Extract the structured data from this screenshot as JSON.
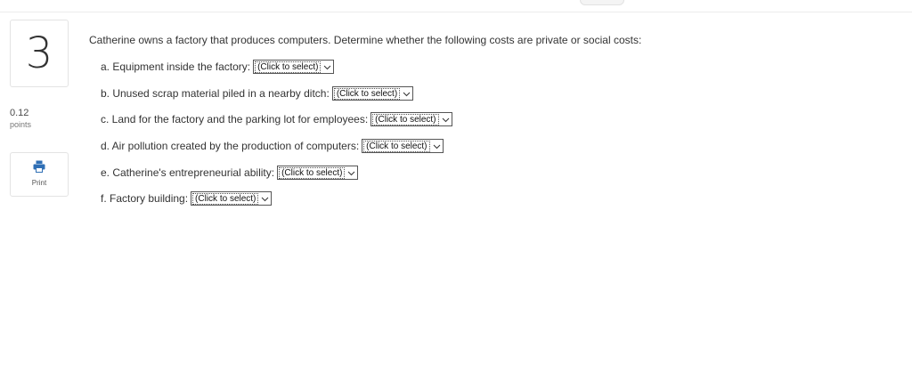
{
  "question": {
    "number": "3",
    "points_value": "0.12",
    "points_label": "points",
    "print_label": "Print",
    "prompt": "Catherine owns a factory that produces computers. Determine whether the following costs are private or social costs:",
    "items": [
      {
        "label": "a. Equipment inside the factory:",
        "selected": "(Click to select)"
      },
      {
        "label": "b. Unused scrap material piled in a nearby ditch:",
        "selected": "(Click to select)"
      },
      {
        "label": "c. Land for the factory and the parking lot for employees:",
        "selected": "(Click to select)"
      },
      {
        "label": "d. Air pollution created by the production of computers:",
        "selected": "(Click to select)"
      },
      {
        "label": "e. Catherine's entrepreneurial ability:",
        "selected": "(Click to select)"
      },
      {
        "label": "f. Factory building:",
        "selected": "(Click to select)"
      }
    ]
  },
  "icons": {
    "print": "printer-icon",
    "dropdown": "chevron-down-icon"
  },
  "colors": {
    "print_icon": "#2f6fb5",
    "border": "#e3e3e3",
    "text": "#333333"
  }
}
